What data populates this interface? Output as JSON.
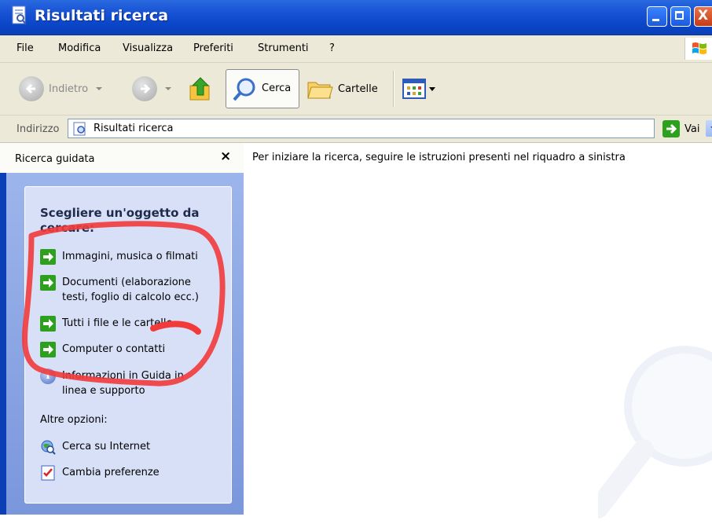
{
  "window": {
    "title": "Risultati ricerca"
  },
  "menu": [
    "File",
    "Modifica",
    "Visualizza",
    "Preferiti",
    "Strumenti",
    "?"
  ],
  "toolbar": {
    "back_label": "Indietro",
    "search_label": "Cerca",
    "folders_label": "Cartelle"
  },
  "address": {
    "label": "Indirizzo",
    "value": "Risultati ricerca",
    "go_label": "Vai"
  },
  "left_pane": {
    "header": "Ricerca guidata",
    "close_glyph": "×",
    "title": "Scegliere un'oggetto da cercare:",
    "options": [
      {
        "label": "Immagini, musica o filmati"
      },
      {
        "label": "Documenti (elaborazione testi, foglio di calcolo ecc.)"
      },
      {
        "label": "Tutti i file e le cartelle"
      },
      {
        "label": "Computer o contatti"
      },
      {
        "label": "Informazioni in Guida in linea e supporto"
      }
    ],
    "more_title": "Altre opzioni:",
    "more_options": [
      {
        "label": "Cerca su Internet"
      },
      {
        "label": "Cambia preferenze"
      }
    ]
  },
  "right_pane": {
    "message": "Per iniziare la ricerca, seguire le istruzioni presenti nel riquadro a sinistra"
  },
  "colors": {
    "title_bar": "#0b46c9",
    "chrome": "#ece9d8",
    "pane_blue": "#7a97dc",
    "annotation_red": "#f23a3a"
  }
}
